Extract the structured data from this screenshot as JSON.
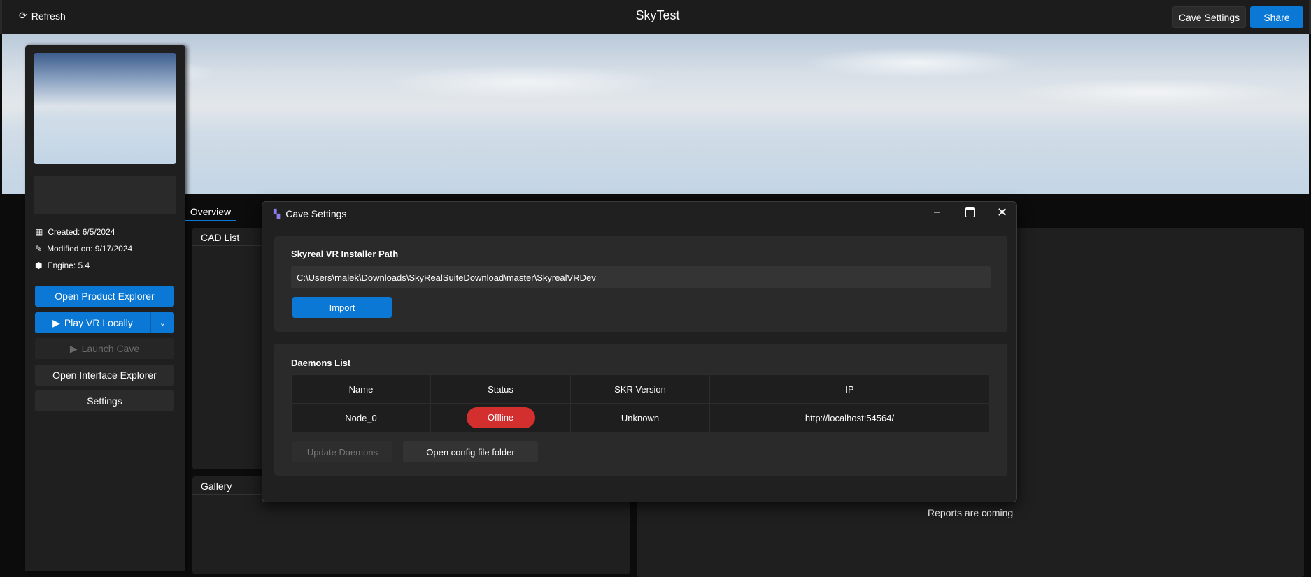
{
  "topbar": {
    "refresh_label": "Refresh",
    "title": "SkyTest",
    "cave_settings_label": "Cave Settings",
    "share_label": "Share"
  },
  "colors": {
    "accent": "#0a78d4",
    "offline": "#d32f2f"
  },
  "project": {
    "created": "Created: 6/5/2024",
    "modified": "Modified on: 9/17/2024",
    "engine": "Engine: 5.4",
    "buttons": {
      "open_product_explorer": "Open Product Explorer",
      "play_vr_locally": "Play VR Locally",
      "launch_cave": "Launch Cave",
      "open_interface_explorer": "Open Interface Explorer",
      "settings": "Settings"
    }
  },
  "tabs": [
    {
      "label": "Overview",
      "active": true
    }
  ],
  "panels": {
    "cad_list": "CAD List",
    "gallery": "Gallery",
    "reports": "Reports are coming"
  },
  "dialog": {
    "title": "Cave Settings",
    "installer": {
      "label": "Skyreal VR Installer Path",
      "path": "C:\\Users\\malek\\Downloads\\SkyRealSuiteDownload\\master\\SkyrealVRDev",
      "import_label": "Import"
    },
    "daemons": {
      "label": "Daemons List",
      "columns": [
        "Name",
        "Status",
        "SKR Version",
        "IP"
      ],
      "rows": [
        {
          "name": "Node_0",
          "status": "Offline",
          "version": "Unknown",
          "ip": "http://localhost:54564/"
        }
      ],
      "update_label": "Update Daemons",
      "open_config_label": "Open config file folder"
    }
  }
}
